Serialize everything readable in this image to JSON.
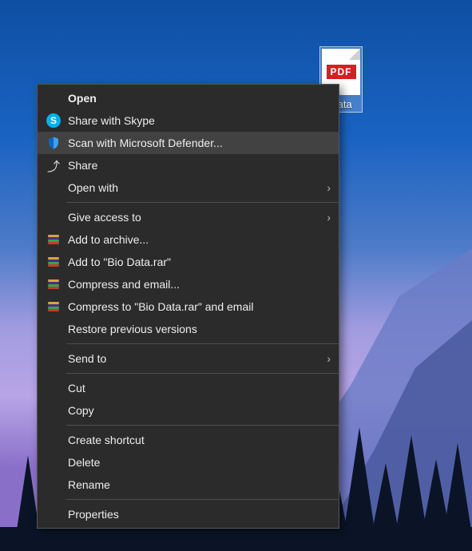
{
  "desktop": {
    "file": {
      "ext_label": "PDF",
      "name": "Data"
    }
  },
  "context_menu": {
    "groups": [
      [
        {
          "id": "open",
          "label": "Open",
          "icon": "",
          "bold": true,
          "submenu": false
        },
        {
          "id": "skype",
          "label": "Share with Skype",
          "icon": "skype",
          "bold": false,
          "submenu": false
        },
        {
          "id": "defender",
          "label": "Scan with Microsoft Defender...",
          "icon": "defender",
          "bold": false,
          "submenu": false,
          "hover": true
        },
        {
          "id": "share",
          "label": "Share",
          "icon": "share",
          "bold": false,
          "submenu": false
        },
        {
          "id": "openwith",
          "label": "Open with",
          "icon": "",
          "bold": false,
          "submenu": true
        }
      ],
      [
        {
          "id": "giveaccess",
          "label": "Give access to",
          "icon": "",
          "bold": false,
          "submenu": true
        },
        {
          "id": "addarchive",
          "label": "Add to archive...",
          "icon": "rar",
          "bold": false,
          "submenu": false
        },
        {
          "id": "addbiodata",
          "label": "Add to \"Bio Data.rar\"",
          "icon": "rar",
          "bold": false,
          "submenu": false
        },
        {
          "id": "compmail",
          "label": "Compress and email...",
          "icon": "rar",
          "bold": false,
          "submenu": false
        },
        {
          "id": "compbiomail",
          "label": "Compress to \"Bio Data.rar\" and email",
          "icon": "rar",
          "bold": false,
          "submenu": false
        },
        {
          "id": "restore",
          "label": "Restore previous versions",
          "icon": "",
          "bold": false,
          "submenu": false
        }
      ],
      [
        {
          "id": "sendto",
          "label": "Send to",
          "icon": "",
          "bold": false,
          "submenu": true
        }
      ],
      [
        {
          "id": "cut",
          "label": "Cut",
          "icon": "",
          "bold": false,
          "submenu": false
        },
        {
          "id": "copy",
          "label": "Copy",
          "icon": "",
          "bold": false,
          "submenu": false
        }
      ],
      [
        {
          "id": "shortcut",
          "label": "Create shortcut",
          "icon": "",
          "bold": false,
          "submenu": false
        },
        {
          "id": "delete",
          "label": "Delete",
          "icon": "",
          "bold": false,
          "submenu": false
        },
        {
          "id": "rename",
          "label": "Rename",
          "icon": "",
          "bold": false,
          "submenu": false
        }
      ],
      [
        {
          "id": "properties",
          "label": "Properties",
          "icon": "",
          "bold": false,
          "submenu": false
        }
      ]
    ]
  }
}
